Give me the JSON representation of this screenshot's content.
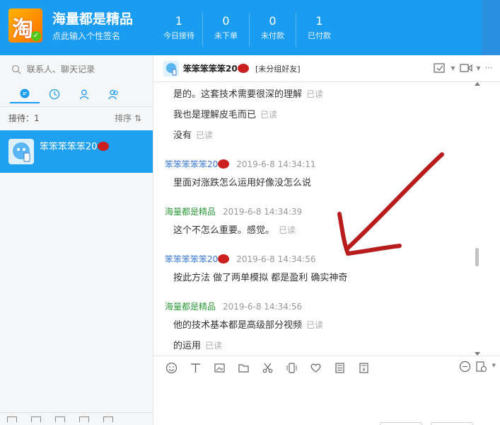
{
  "header": {
    "logo_glyph": "淘",
    "shop_name": "海量都是精品",
    "signature_placeholder": "点此输入个性签名",
    "stats": [
      {
        "value": "1",
        "label": "今日接待"
      },
      {
        "value": "0",
        "label": "未下单"
      },
      {
        "value": "0",
        "label": "未付款"
      },
      {
        "value": "1",
        "label": "已付款"
      }
    ]
  },
  "sidebar": {
    "search_placeholder": "联系人、聊天记录",
    "receive_label": "接待：1",
    "sort_label": "排序 ⇅",
    "contact": {
      "name": "笨笨笨笨笨20"
    }
  },
  "chat": {
    "title": "笨笨笨笨笨20",
    "group": "[未分组好友]",
    "more_label": "···",
    "read_label": "已读",
    "messages": [
      {
        "kind": "text",
        "text": "是的。这套技术需要很深的理解",
        "read": true
      },
      {
        "kind": "text",
        "text": "我也是理解皮毛而已",
        "read": true
      },
      {
        "kind": "text",
        "text": "没有",
        "read": true
      },
      {
        "kind": "head",
        "sender": "笨笨笨笨笨20",
        "time": "2019-6-8 14:34:11",
        "color": "blue"
      },
      {
        "kind": "text",
        "text": "里面对涨跌怎么运用好像没怎么说",
        "read": false
      },
      {
        "kind": "head",
        "sender": "海量都是精品",
        "time": "2019-6-8 14:34:39",
        "color": "green"
      },
      {
        "kind": "text",
        "text": "这个不怎么重要。感觉。",
        "read": true
      },
      {
        "kind": "head",
        "sender": "笨笨笨笨笨20",
        "time": "2019-6-8 14:34:56",
        "color": "blue"
      },
      {
        "kind": "text",
        "text": "按此方法 做了两单模拟 都是盈利 确实神奇",
        "read": false
      },
      {
        "kind": "head",
        "sender": "海量都是精品",
        "time": "2019-6-8 14:34:56",
        "color": "green"
      },
      {
        "kind": "text",
        "text": "他的技术基本都是高级部分视频",
        "read": true
      },
      {
        "kind": "text",
        "text": "的运用",
        "read": true
      }
    ]
  },
  "colors": {
    "header_blue": "#1a9cf0",
    "sender_blue": "#3b7ad5",
    "sender_green": "#2e9a3a",
    "annotation_red": "#b81c1c"
  }
}
